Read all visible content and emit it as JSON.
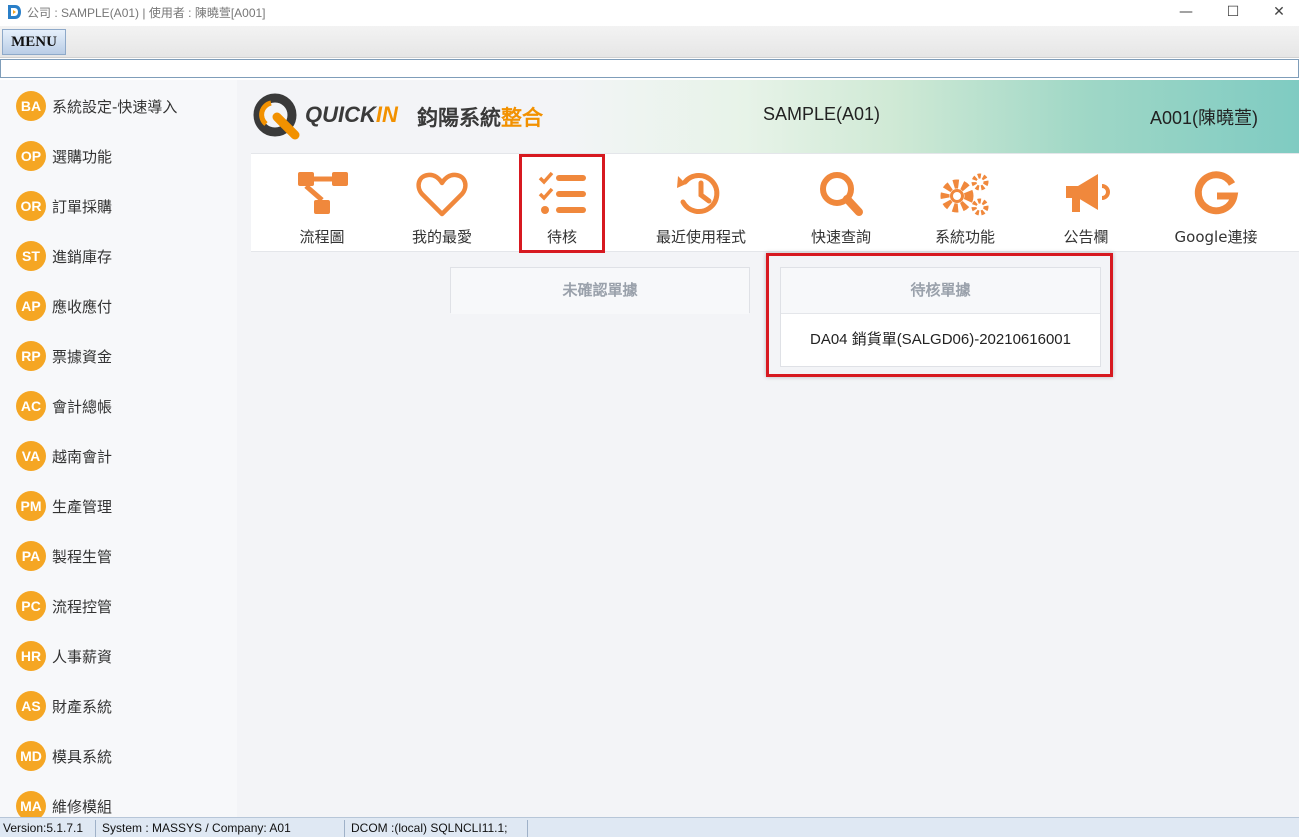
{
  "window": {
    "title": "公司 : SAMPLE(A01) | 使用者 : 陳曉萱[A001]",
    "minimize": "—",
    "maximize": "☐",
    "close": "✕"
  },
  "menu": {
    "label": "MENU"
  },
  "sidebar": {
    "items": [
      {
        "code": "BA",
        "label": "系統設定-快速導入"
      },
      {
        "code": "OP",
        "label": "選購功能"
      },
      {
        "code": "OR",
        "label": "訂單採購"
      },
      {
        "code": "ST",
        "label": "進銷庫存"
      },
      {
        "code": "AP",
        "label": "應收應付"
      },
      {
        "code": "RP",
        "label": "票據資金"
      },
      {
        "code": "AC",
        "label": "會計總帳"
      },
      {
        "code": "VA",
        "label": "越南會計"
      },
      {
        "code": "PM",
        "label": "生產管理"
      },
      {
        "code": "PA",
        "label": "製程生管"
      },
      {
        "code": "PC",
        "label": "流程控管"
      },
      {
        "code": "HR",
        "label": "人事薪資"
      },
      {
        "code": "AS",
        "label": "財產系統"
      },
      {
        "code": "MD",
        "label": "模具系統"
      },
      {
        "code": "MA",
        "label": "維修模組"
      }
    ]
  },
  "header": {
    "brand_q": "QUICK",
    "brand_in": "IN",
    "brand_cn": "鈞陽系統",
    "brand_cn_highlight": "整合",
    "company": "SAMPLE(A01)",
    "user": "A001(陳曉萱)"
  },
  "toolbar": {
    "items": [
      {
        "label": "流程圖",
        "icon": "flowchart-icon"
      },
      {
        "label": "我的最愛",
        "icon": "heart-icon"
      },
      {
        "label": "待核",
        "icon": "checklist-icon",
        "selected": true
      },
      {
        "label": "最近使用程式",
        "icon": "history-icon"
      },
      {
        "label": "快速查詢",
        "icon": "search-icon"
      },
      {
        "label": "系統功能",
        "icon": "gears-icon"
      },
      {
        "label": "公告欄",
        "icon": "megaphone-icon"
      },
      {
        "label": "Google連接",
        "icon": "google-icon"
      }
    ],
    "icon_color": "#f0883c"
  },
  "panels": {
    "unconfirmed": {
      "title": "未確認單據"
    },
    "pending": {
      "title": "待核單據",
      "rows": [
        "DA04 銷貨單(SALGD06)-20210616001"
      ]
    }
  },
  "status": {
    "version": "Version:5.1.7.1",
    "system": "System : MASSYS  / Company: A01",
    "dcom": "DCOM  :(local) SQLNCLI11.1;"
  }
}
